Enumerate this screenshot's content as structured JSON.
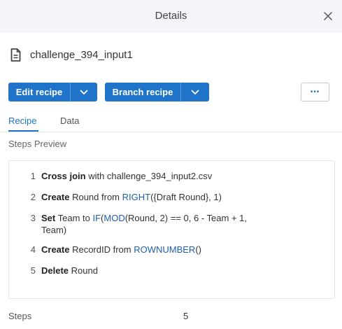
{
  "header": {
    "title": "Details"
  },
  "file": {
    "name": "challenge_394_input1"
  },
  "toolbar": {
    "edit_label": "Edit recipe",
    "branch_label": "Branch recipe",
    "more_label": "•••"
  },
  "tabs": [
    {
      "label": "Recipe"
    },
    {
      "label": "Data"
    }
  ],
  "steps_preview": {
    "label": "Steps Preview",
    "steps": [
      {
        "num": "1",
        "parts": [
          {
            "t": "Cross join",
            "k": "kw"
          },
          {
            "t": " with challenge_394_input2.csv",
            "k": "txt"
          }
        ]
      },
      {
        "num": "2",
        "parts": [
          {
            "t": "Create",
            "k": "kw"
          },
          {
            "t": " Round from ",
            "k": "txt"
          },
          {
            "t": "RIGHT",
            "k": "fn"
          },
          {
            "t": "({Draft Round}, 1)",
            "k": "txt"
          }
        ]
      },
      {
        "num": "3",
        "parts": [
          {
            "t": "Set",
            "k": "kw"
          },
          {
            "t": " Team to ",
            "k": "txt"
          },
          {
            "t": "IF",
            "k": "fn"
          },
          {
            "t": "(",
            "k": "txt"
          },
          {
            "t": "MOD",
            "k": "fn"
          },
          {
            "t": "(Round, 2) == 0, 6 - Team + 1, Team)",
            "k": "txt"
          }
        ]
      },
      {
        "num": "4",
        "parts": [
          {
            "t": "Create",
            "k": "kw"
          },
          {
            "t": " RecordID from ",
            "k": "txt"
          },
          {
            "t": "ROWNUMBER",
            "k": "fn"
          },
          {
            "t": "()",
            "k": "txt"
          }
        ]
      },
      {
        "num": "5",
        "parts": [
          {
            "t": "Delete",
            "k": "kw"
          },
          {
            "t": " Round",
            "k": "txt"
          }
        ]
      }
    ]
  },
  "footer": {
    "steps_label": "Steps",
    "steps_value": "5"
  },
  "colors": {
    "primary": "#1f73c9",
    "function_text": "#1f5fa8",
    "header_bg": "#f3f5f8"
  },
  "icons": {
    "file": "file-text-icon",
    "close": "close-icon",
    "caret": "chevron-down-icon",
    "more": "more-horizontal-icon"
  }
}
